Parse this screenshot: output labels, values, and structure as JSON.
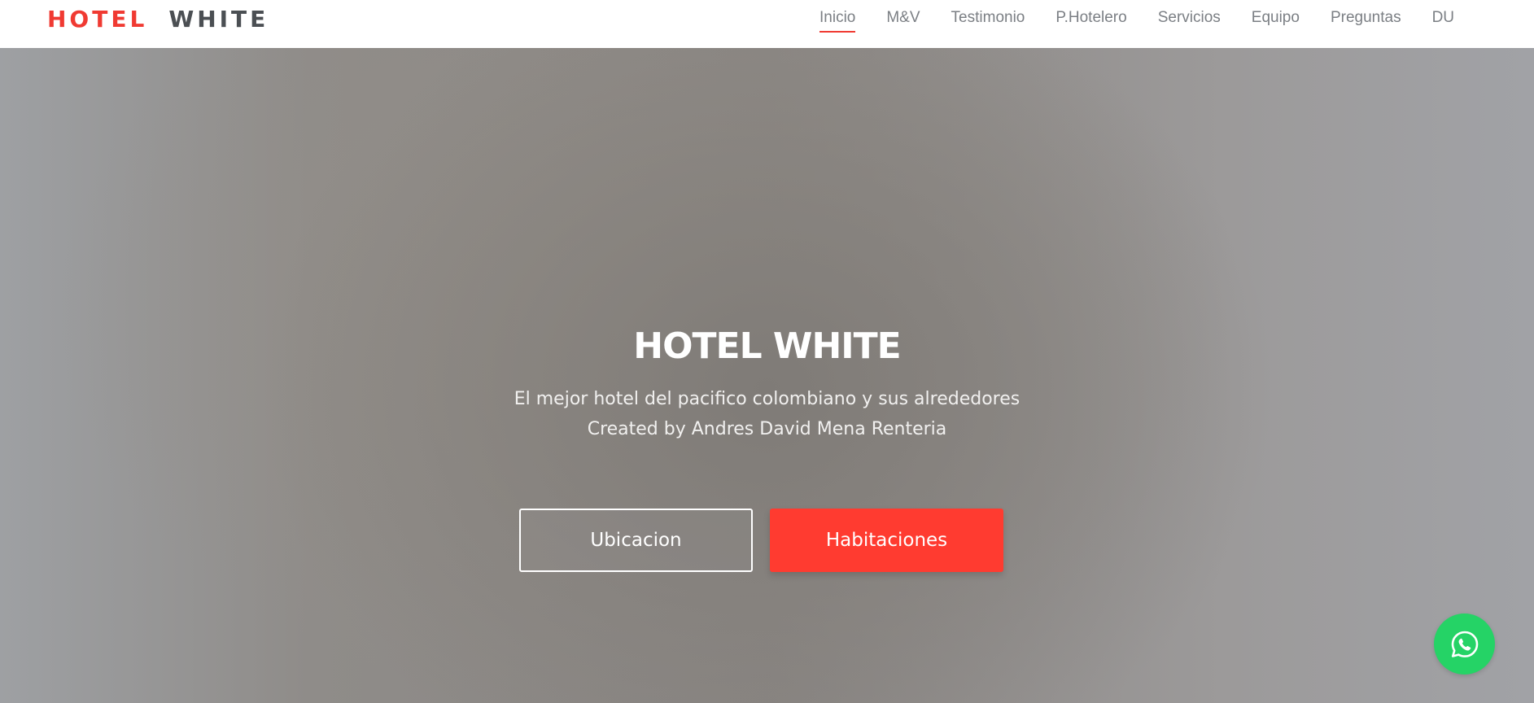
{
  "brand": {
    "part1": "HOTEL",
    "part2": "WHITE",
    "accent_color": "#f03a32",
    "text_color": "#4b4f53"
  },
  "nav": {
    "items": [
      {
        "label": "Inicio",
        "active": true
      },
      {
        "label": "M&V"
      },
      {
        "label": "Testimonio"
      },
      {
        "label": "P.Hotelero"
      },
      {
        "label": "Servicios"
      },
      {
        "label": "Equipo"
      },
      {
        "label": "Preguntas"
      },
      {
        "label": "DU"
      }
    ]
  },
  "hero": {
    "title": "HOTEL WHITE",
    "subtitle_line1": "El mejor hotel del pacifico colombiano y sus alrededores",
    "subtitle_line2": "Created by Andres David Mena Renteria",
    "primary_button": "Ubicacion",
    "secondary_button": "Habitaciones",
    "button_color": "#ff3b30"
  },
  "whatsapp": {
    "icon": "whatsapp-icon",
    "color": "#25d366"
  }
}
